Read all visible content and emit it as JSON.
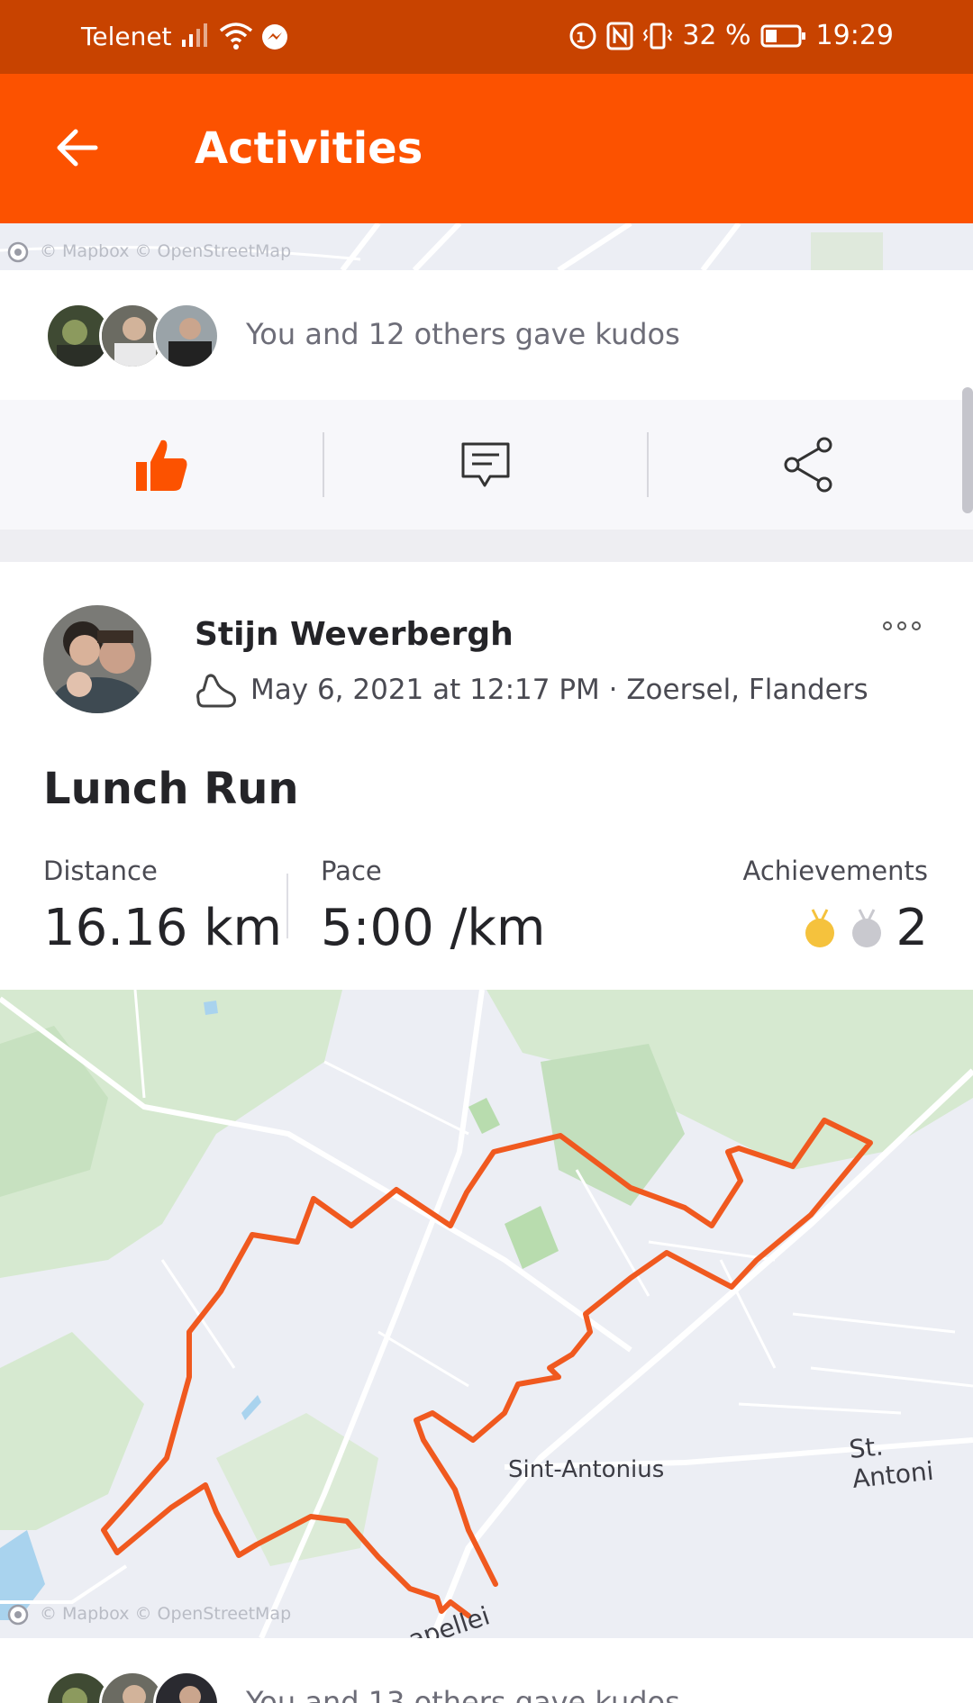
{
  "status_bar": {
    "carrier": "Telenet",
    "battery": "32 %",
    "time": "19:29"
  },
  "app_bar": {
    "title": "Activities"
  },
  "map": {
    "attribution": "© Mapbox © OpenStreetMap",
    "place_label": "Sint-Antonius",
    "road_label_1": "St. Antoni",
    "road_label_2": "apellei"
  },
  "kudos": {
    "text": "You and 12 others gave kudos",
    "bottom_text": "You and 13 others gave kudos"
  },
  "activity": {
    "athlete_name": "Stijn Weverbergh",
    "meta": "May 6, 2021 at 12:17 PM · Zoersel, Flanders",
    "title": "Lunch Run",
    "stats": {
      "distance_label": "Distance",
      "distance_value": "16.16 km",
      "pace_label": "Pace",
      "pace_value": "5:00 /km",
      "achievements_label": "Achievements",
      "achievements_value": "2"
    }
  },
  "colors": {
    "brand": "#fc5200",
    "status_bar": "#c84300",
    "route": "#f0591f",
    "gold_medal": "#f5c23d",
    "silver_medal": "#c9c9cf"
  }
}
